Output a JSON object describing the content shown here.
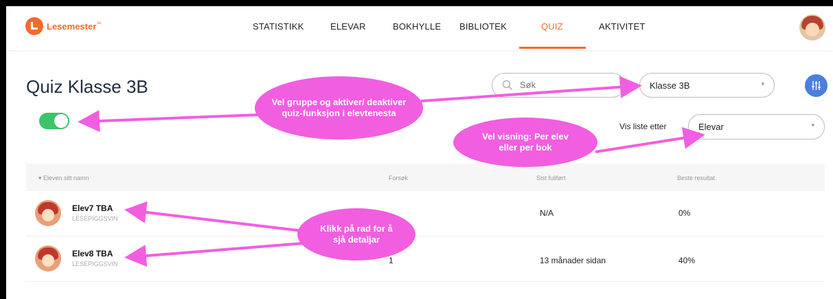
{
  "app": {
    "brand": "Lesemester",
    "trademark": "™"
  },
  "nav": {
    "tabs": [
      {
        "label": "STATISTIKK"
      },
      {
        "label": "ELEVAR"
      },
      {
        "label": "BOKHYLLE"
      },
      {
        "label": "BIBLIOTEK"
      },
      {
        "label": "QUIZ",
        "active": true
      },
      {
        "label": "AKTIVITET"
      }
    ]
  },
  "header": {
    "title": "Quiz Klasse 3B",
    "quiz_enabled": true,
    "search": {
      "placeholder": "Søk"
    },
    "group_select": {
      "value": "Klasse 3B"
    },
    "view_label": "Vis liste etter",
    "view_select": {
      "value": "Elevar"
    }
  },
  "table": {
    "columns": [
      "Eleven sitt namn",
      "Forsøk",
      "Sist fullført",
      "Beste resultat"
    ],
    "rows": [
      {
        "name": "Elev7 TBA",
        "school": "LESEPIGGSVIN",
        "attempts": "",
        "last_completed": "N/A",
        "best": "0%"
      },
      {
        "name": "Elev8 TBA",
        "school": "LESEPIGGSVIN",
        "attempts": "1",
        "last_completed": "13 månader sidan",
        "best": "40%"
      }
    ]
  },
  "annotations": {
    "group": "Vel gruppe og aktiver/ deaktiver quiz-funksjon i elevtenesta",
    "view": "Vel visning: Per elev eller per bok",
    "row": "Klikk på rad for å sjå detaljar"
  },
  "colors": {
    "accent": "#f26a2c",
    "toggle": "#3cc46a",
    "annotation": "#f25ee0",
    "filter": "#4a7fe0"
  }
}
